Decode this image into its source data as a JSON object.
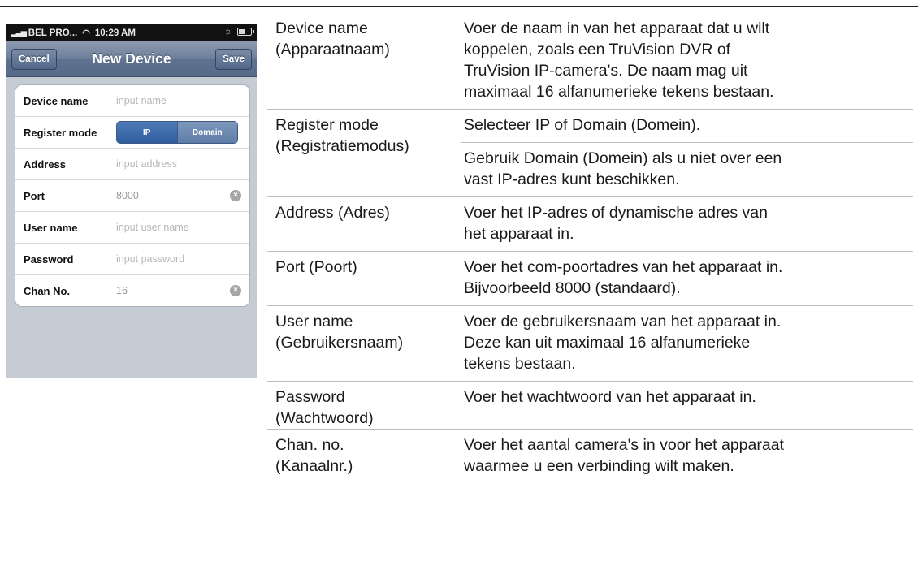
{
  "phone": {
    "status": {
      "carrier": "BEL PRO...",
      "time": "10:29 AM"
    },
    "nav": {
      "cancel": "Cancel",
      "title": "New Device",
      "save": "Save"
    },
    "fields": {
      "device_name": {
        "label": "Device name",
        "placeholder": "input name"
      },
      "register_mode": {
        "label": "Register mode",
        "options": [
          "IP",
          "Domain"
        ],
        "selected": "IP"
      },
      "address": {
        "label": "Address",
        "placeholder": "input address"
      },
      "port": {
        "label": "Port",
        "value": "8000"
      },
      "user_name": {
        "label": "User name",
        "placeholder": "input user name"
      },
      "password": {
        "label": "Password",
        "placeholder": "input password"
      },
      "chan_no": {
        "label": "Chan No.",
        "value": "16"
      }
    },
    "icons": {
      "signal": "signal-bars-icon",
      "wifi": "wifi-icon",
      "brightness": "brightness-icon",
      "battery": "battery-icon",
      "clear": "clear-icon"
    }
  },
  "table": {
    "rows": [
      {
        "label": [
          "Device name",
          "(Apparaatnaam)"
        ],
        "paras": [
          [
            "Voer de naam in van het apparaat dat u wilt",
            "koppelen, zoals een TruVision DVR of",
            "TruVision IP-camera's. De naam mag uit",
            "maximaal 16 alfanumerieke tekens bestaan."
          ]
        ]
      },
      {
        "label": [
          "Register mode",
          "(Registratiemodus)"
        ],
        "paras": [
          [
            "Selecteer IP of Domain (Domein)."
          ],
          [
            "Gebruik Domain (Domein) als u niet over een",
            "vast IP-adres kunt beschikken."
          ]
        ]
      },
      {
        "label": [
          "Address (Adres)"
        ],
        "paras": [
          [
            "Voer het IP-adres of dynamische adres van",
            "het apparaat in."
          ]
        ]
      },
      {
        "label": [
          "Port (Poort)"
        ],
        "paras": [
          [
            "Voer het com-poortadres van het apparaat in.",
            "Bijvoorbeeld 8000 (standaard)."
          ]
        ]
      },
      {
        "label": [
          "User name",
          "(Gebruikersnaam)"
        ],
        "paras": [
          [
            "Voer de gebruikersnaam van het apparaat in.",
            "Deze kan uit maximaal 16 alfanumerieke",
            "tekens bestaan."
          ]
        ]
      },
      {
        "label": [
          "Password",
          "(Wachtwoord)"
        ],
        "paras": [
          [
            "Voer het wachtwoord van het apparaat in."
          ]
        ]
      },
      {
        "label": [
          "Chan. no.",
          "(Kanaalnr.)"
        ],
        "paras": [
          [
            "Voer het aantal camera's in voor het apparaat",
            "waarmee u een verbinding wilt maken."
          ]
        ]
      }
    ]
  }
}
